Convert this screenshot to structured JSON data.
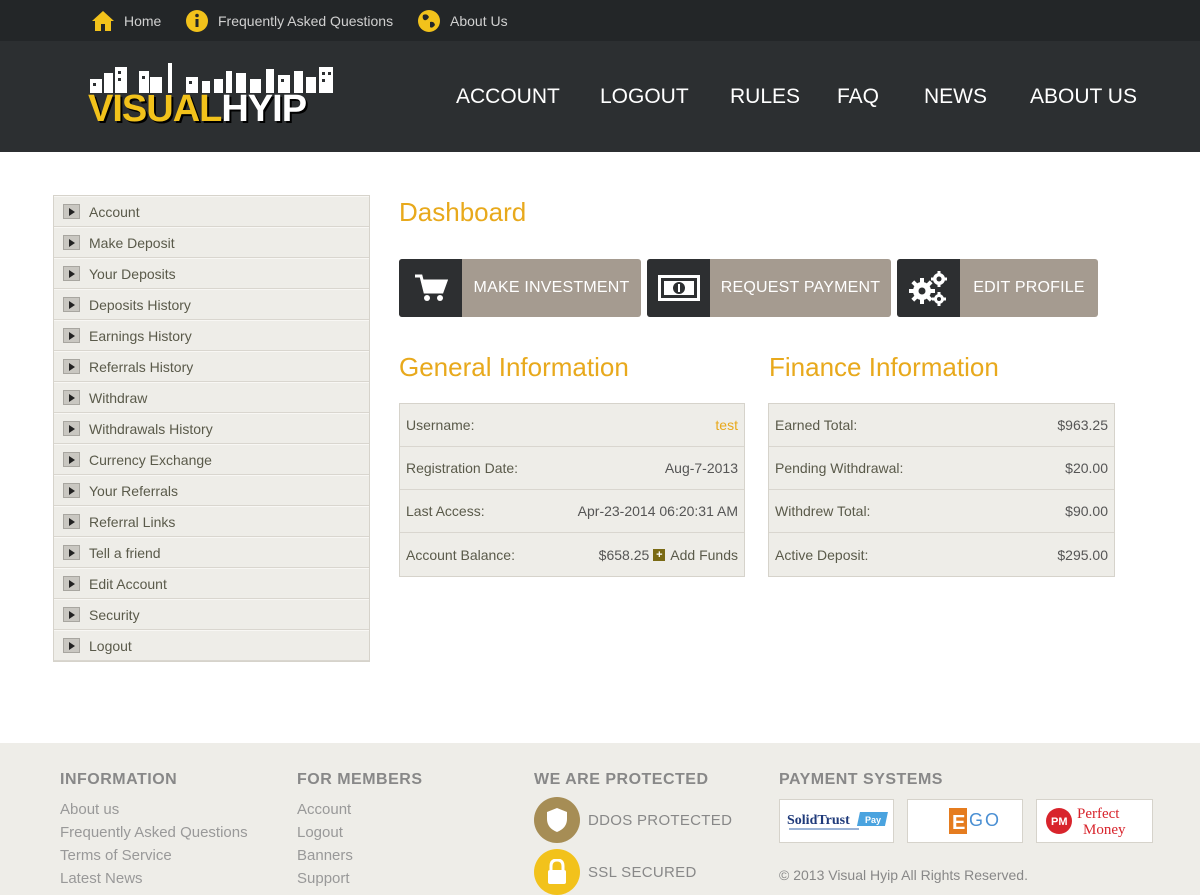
{
  "topbar": {
    "links": [
      {
        "label": "Home",
        "icon": "home-icon"
      },
      {
        "label": "Frequently Asked Questions",
        "icon": "info-icon"
      },
      {
        "label": "About Us",
        "icon": "globe-icon"
      }
    ]
  },
  "logo": {
    "part1": "VISUAL",
    "part2": "HYIP"
  },
  "nav": [
    "ACCOUNT",
    "LOGOUT",
    "RULES",
    "FAQ",
    "NEWS",
    "ABOUT US"
  ],
  "sidebar": {
    "items": [
      "Account",
      "Make Deposit",
      "Your Deposits",
      "Deposits History",
      "Earnings History",
      "Referrals History",
      "Withdraw",
      "Withdrawals History",
      "Currency Exchange",
      "Your Referrals",
      "Referral Links",
      "Tell a friend",
      "Edit Account",
      "Security",
      "Logout"
    ]
  },
  "dashboard": {
    "title": "Dashboard",
    "actions": [
      {
        "label": "MAKE INVESTMENT",
        "icon": "cart-icon"
      },
      {
        "label": "REQUEST PAYMENT",
        "icon": "banknote-icon"
      },
      {
        "label": "EDIT PROFILE",
        "icon": "gears-icon"
      }
    ]
  },
  "general": {
    "title": "General Information",
    "rows": [
      {
        "label": "Username:",
        "value": "test"
      },
      {
        "label": "Registration Date:",
        "value": "Aug-7-2013"
      },
      {
        "label": "Last Access:",
        "value": "Apr-23-2014 06:20:31 AM"
      },
      {
        "label": "Account Balance:",
        "value": "$658.25",
        "extra": "Add Funds"
      }
    ]
  },
  "finance": {
    "title": "Finance Information",
    "rows": [
      {
        "label": "Earned Total:",
        "value": "$963.25"
      },
      {
        "label": "Pending Withdrawal:",
        "value": "$20.00"
      },
      {
        "label": "Withdrew Total:",
        "value": "$90.00"
      },
      {
        "label": "Active Deposit:",
        "value": "$295.00"
      }
    ]
  },
  "footer": {
    "info": {
      "title": "INFORMATION",
      "links": [
        "About us",
        "Frequently Asked Questions",
        "Terms of Service",
        "Latest News"
      ]
    },
    "members": {
      "title": "FOR MEMBERS",
      "links": [
        "Account",
        "Logout",
        "Banners",
        "Support"
      ]
    },
    "protected": {
      "title": "WE ARE PROTECTED",
      "items": [
        "DDOS PROTECTED",
        "SSL SECURED"
      ]
    },
    "payment": {
      "title": "PAYMENT SYSTEMS",
      "logos": [
        "SolidTrust Pay",
        "EGO PAY",
        "Perfect Money"
      ],
      "pm_badge": "PM",
      "pm_line1": "Perfect",
      "pm_line2": "Money"
    },
    "copyright": "© 2013 Visual Hyip All Rights Reserved."
  },
  "colors": {
    "accent": "#e8a91c",
    "dark": "#2c2f31",
    "button": "#a59b90"
  }
}
